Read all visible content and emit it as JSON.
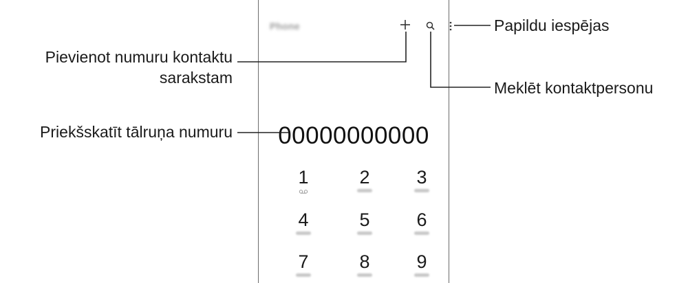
{
  "app": {
    "title": "Phone"
  },
  "header_icons": {
    "add": "plus-icon",
    "search": "search-icon",
    "more": "more-vertical-icon"
  },
  "dialer": {
    "number": "00000000000",
    "keys": [
      {
        "digit": "1",
        "sub": "voicemail-icon"
      },
      {
        "digit": "2",
        "sub": "ABC"
      },
      {
        "digit": "3",
        "sub": "DEF"
      },
      {
        "digit": "4",
        "sub": "GHI"
      },
      {
        "digit": "5",
        "sub": "JKL"
      },
      {
        "digit": "6",
        "sub": "MNO"
      },
      {
        "digit": "7",
        "sub": "PQRS"
      },
      {
        "digit": "8",
        "sub": "TUV"
      },
      {
        "digit": "9",
        "sub": "WXYZ"
      }
    ]
  },
  "callouts": {
    "more_options": "Papildu iespējas",
    "add_contact_line1": "Pievienot numuru kontaktu",
    "add_contact_line2": "sarakstam",
    "search_contact": "Meklēt kontaktpersonu",
    "preview_number": "Priekšskatīt tālruņa numuru"
  },
  "colors": {
    "line": "#222222",
    "frame": "#6b6b6b",
    "text": "#1a1a1a"
  }
}
